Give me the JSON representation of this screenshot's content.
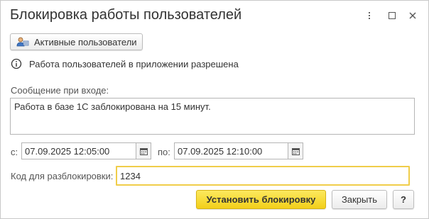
{
  "window": {
    "title": "Блокировка работы пользователей",
    "controls": {
      "more_icon": "more-vertical-icon",
      "maximize_icon": "maximize-icon",
      "close_icon": "close-icon"
    }
  },
  "toolbar": {
    "active_users_label": "Активные пользователи",
    "active_users_icon": "users-icon"
  },
  "info": {
    "icon": "info-icon",
    "text": "Работа пользователей в приложении разрешена"
  },
  "message": {
    "label": "Сообщение при входе:",
    "value": "Работа в базе 1С заблокирована на 15 минут."
  },
  "period": {
    "from_label": "с:",
    "from_value": "07.09.2025 12:05:00",
    "to_label": "по:",
    "to_value": "07.09.2025 12:10:00",
    "calendar_icon": "calendar-icon"
  },
  "unlock_code": {
    "label": "Код для разблокировки:",
    "value": "1234"
  },
  "footer": {
    "set_lock_label": "Установить блокировку",
    "close_label": "Закрыть",
    "help_label": "?"
  },
  "colors": {
    "primary_button": "#f5d62e",
    "focus_border": "#f0cd4a",
    "border": "#b5b5b5"
  }
}
